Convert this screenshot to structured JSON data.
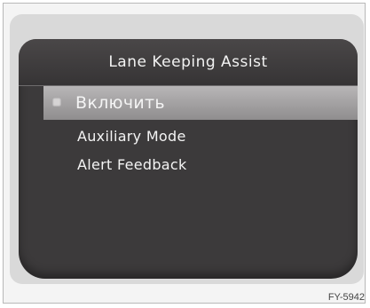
{
  "screen": {
    "title": "Lane Keeping Assist",
    "menu": [
      {
        "label": "Включить",
        "selected": true
      },
      {
        "label": "Auxiliary Mode",
        "selected": false
      },
      {
        "label": "Alert Feedback",
        "selected": false
      }
    ]
  },
  "figure_code": "FY-5942",
  "colors": {
    "screen_bg": "#3c3a3b",
    "selected_bg": "#a8a6a7",
    "text": "#f4f4f4"
  }
}
